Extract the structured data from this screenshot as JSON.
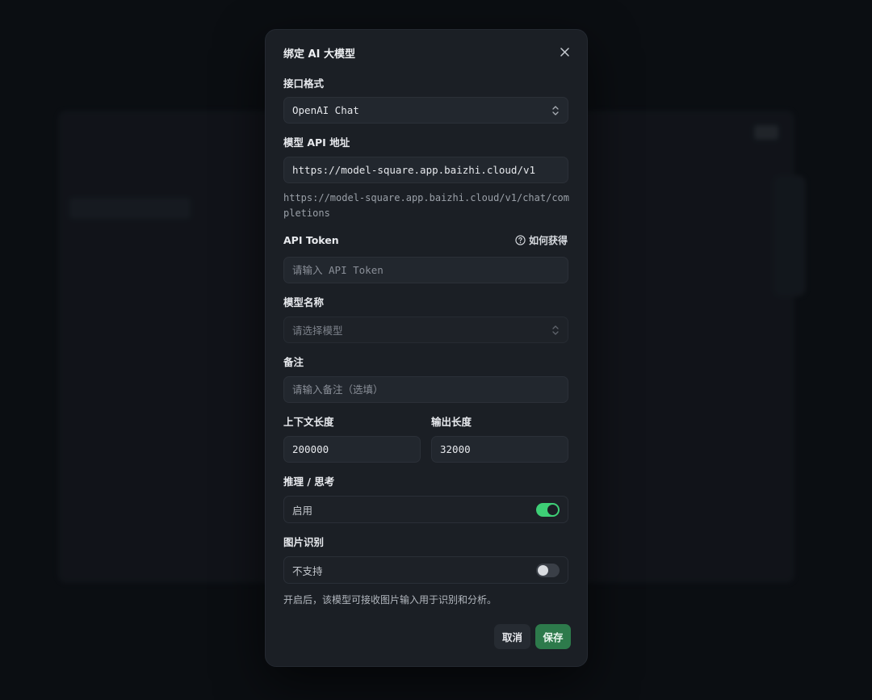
{
  "background": {
    "title": "",
    "sidebar": {
      "brand": "",
      "items": [
        "",
        "",
        "",
        "",
        "",
        "",
        ""
      ]
    },
    "main_heading": "",
    "main_sub": ""
  },
  "dialog": {
    "title": "绑定 AI 大模型",
    "interface_format": {
      "label": "接口格式",
      "value": "OpenAI Chat"
    },
    "api_url": {
      "label": "模型 API 地址",
      "value": "https://model-square.app.baizhi.cloud/v1",
      "resolved": "https://model-square.app.baizhi.cloud/v1/chat/completions"
    },
    "api_token": {
      "label": "API Token",
      "help_link": "如何获得",
      "placeholder": "请输入 API Token"
    },
    "model_name": {
      "label": "模型名称",
      "placeholder": "请选择模型"
    },
    "remark": {
      "label": "备注",
      "placeholder": "请输入备注（选填）"
    },
    "context_length": {
      "label": "上下文长度",
      "value": "200000"
    },
    "output_length": {
      "label": "输出长度",
      "value": "32000"
    },
    "reasoning": {
      "label": "推理 / 思考",
      "status": "启用",
      "enabled": true
    },
    "image_recognition": {
      "label": "图片识别",
      "status": "不支持",
      "enabled": false
    },
    "helper_text": "开启后，该模型可接收图片输入用于识别和分析。",
    "cancel_label": "取消",
    "save_label": "保存"
  },
  "colors": {
    "accent_green": "#3ecf76",
    "save_button": "#2d7a4b",
    "dialog_bg": "#1b1f25"
  }
}
